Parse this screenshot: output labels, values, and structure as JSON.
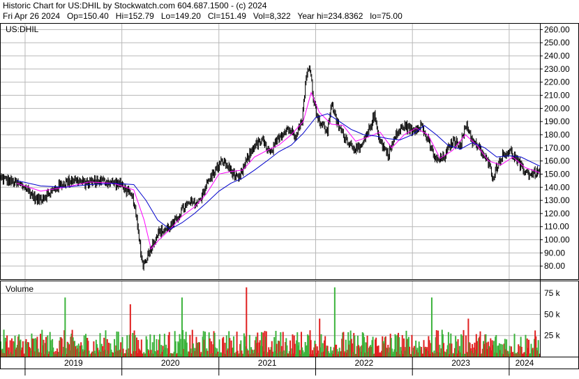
{
  "header": {
    "line1": "Historic Chart for US:DHIL by Stockwatch.com 604.687.1500 - (c) 2024",
    "line2": "Fri Apr 26 2024   Op=150.40   Hi=152.79   Lo=149.20   Cl=151.49   Vol=8,322   Year hi=234.8362   lo=75.00"
  },
  "colors": {
    "price": "#000000",
    "ma_short": "#ff00ff",
    "ma_long": "#0000cc",
    "vol_up": "#3cb33c",
    "vol_down": "#e02020",
    "grid": "#b8b8b8",
    "frame": "#000000"
  },
  "chart_data": [
    {
      "type": "line",
      "panel": "price",
      "title": "US:DHIL",
      "ylim": [
        70,
        265
      ],
      "y_ticks": [
        80,
        90,
        100,
        110,
        120,
        130,
        140,
        150,
        160,
        170,
        180,
        190,
        200,
        210,
        220,
        230,
        240,
        250,
        260
      ],
      "x_tick_labels": [
        "2019",
        "2020",
        "2021",
        "2022",
        "2023",
        "2024"
      ],
      "x_start": "2018-10-01",
      "x_end": "2024-04-26",
      "grid": true,
      "series": [
        {
          "values": [
            {
              "date": "2018-10-01",
              "value": 147
            },
            {
              "date": "2018-11-15",
              "value": 144
            },
            {
              "date": "2019-01-01",
              "value": 140
            },
            {
              "date": "2019-02-15",
              "value": 130
            },
            {
              "date": "2019-04-01",
              "value": 135
            },
            {
              "date": "2019-05-15",
              "value": 142
            },
            {
              "date": "2019-07-01",
              "value": 146
            },
            {
              "date": "2019-08-15",
              "value": 143
            },
            {
              "date": "2019-10-01",
              "value": 145
            },
            {
              "date": "2019-11-15",
              "value": 144
            },
            {
              "date": "2020-01-01",
              "value": 142
            },
            {
              "date": "2020-02-15",
              "value": 130
            },
            {
              "date": "2020-03-20",
              "value": 80
            },
            {
              "date": "2020-04-15",
              "value": 92
            },
            {
              "date": "2020-05-15",
              "value": 105
            },
            {
              "date": "2020-06-15",
              "value": 108
            },
            {
              "date": "2020-07-15",
              "value": 112
            },
            {
              "date": "2020-08-15",
              "value": 123
            },
            {
              "date": "2020-09-15",
              "value": 128
            },
            {
              "date": "2020-10-15",
              "value": 128
            },
            {
              "date": "2020-11-15",
              "value": 142
            },
            {
              "date": "2020-12-15",
              "value": 152
            },
            {
              "date": "2021-01-15",
              "value": 160
            },
            {
              "date": "2021-02-15",
              "value": 153
            },
            {
              "date": "2021-03-15",
              "value": 145
            },
            {
              "date": "2021-04-15",
              "value": 160
            },
            {
              "date": "2021-05-15",
              "value": 172
            },
            {
              "date": "2021-06-15",
              "value": 175
            },
            {
              "date": "2021-07-15",
              "value": 165
            },
            {
              "date": "2021-08-15",
              "value": 178
            },
            {
              "date": "2021-09-15",
              "value": 185
            },
            {
              "date": "2021-10-15",
              "value": 180
            },
            {
              "date": "2021-11-10",
              "value": 190
            },
            {
              "date": "2021-11-25",
              "value": 222
            },
            {
              "date": "2021-12-10",
              "value": 233
            },
            {
              "date": "2021-12-25",
              "value": 205
            },
            {
              "date": "2022-01-15",
              "value": 190
            },
            {
              "date": "2022-02-15",
              "value": 182
            },
            {
              "date": "2022-03-01",
              "value": 205
            },
            {
              "date": "2022-03-20",
              "value": 190
            },
            {
              "date": "2022-04-15",
              "value": 180
            },
            {
              "date": "2022-05-15",
              "value": 172
            },
            {
              "date": "2022-06-15",
              "value": 168
            },
            {
              "date": "2022-07-15",
              "value": 180
            },
            {
              "date": "2022-08-10",
              "value": 195
            },
            {
              "date": "2022-09-01",
              "value": 175
            },
            {
              "date": "2022-10-01",
              "value": 165
            },
            {
              "date": "2022-11-01",
              "value": 180
            },
            {
              "date": "2022-12-01",
              "value": 187
            },
            {
              "date": "2023-01-01",
              "value": 183
            },
            {
              "date": "2023-02-01",
              "value": 188
            },
            {
              "date": "2023-03-01",
              "value": 175
            },
            {
              "date": "2023-04-01",
              "value": 160
            },
            {
              "date": "2023-05-01",
              "value": 163
            },
            {
              "date": "2023-06-01",
              "value": 175
            },
            {
              "date": "2023-07-01",
              "value": 173
            },
            {
              "date": "2023-07-25",
              "value": 188
            },
            {
              "date": "2023-08-15",
              "value": 175
            },
            {
              "date": "2023-09-15",
              "value": 168
            },
            {
              "date": "2023-10-15",
              "value": 158
            },
            {
              "date": "2023-11-01",
              "value": 148
            },
            {
              "date": "2023-12-01",
              "value": 163
            },
            {
              "date": "2024-01-01",
              "value": 168
            },
            {
              "date": "2024-01-25",
              "value": 162
            },
            {
              "date": "2024-02-15",
              "value": 155
            },
            {
              "date": "2024-03-15",
              "value": 150
            },
            {
              "date": "2024-04-26",
              "value": 151.49
            }
          ]
        },
        {
          "values": [
            {
              "date": "2018-12-01",
              "value": 143
            },
            {
              "date": "2019-03-01",
              "value": 137
            },
            {
              "date": "2019-06-01",
              "value": 140
            },
            {
              "date": "2019-09-01",
              "value": 144
            },
            {
              "date": "2019-12-01",
              "value": 143
            },
            {
              "date": "2020-02-15",
              "value": 138
            },
            {
              "date": "2020-03-25",
              "value": 115
            },
            {
              "date": "2020-04-20",
              "value": 93
            },
            {
              "date": "2020-05-20",
              "value": 100
            },
            {
              "date": "2020-07-01",
              "value": 108
            },
            {
              "date": "2020-08-15",
              "value": 118
            },
            {
              "date": "2020-10-01",
              "value": 125
            },
            {
              "date": "2020-11-15",
              "value": 135
            },
            {
              "date": "2021-01-01",
              "value": 150
            },
            {
              "date": "2021-02-15",
              "value": 152
            },
            {
              "date": "2021-04-01",
              "value": 153
            },
            {
              "date": "2021-05-15",
              "value": 163
            },
            {
              "date": "2021-07-01",
              "value": 168
            },
            {
              "date": "2021-08-15",
              "value": 172
            },
            {
              "date": "2021-10-01",
              "value": 180
            },
            {
              "date": "2021-11-15",
              "value": 190
            },
            {
              "date": "2021-12-15",
              "value": 212
            },
            {
              "date": "2022-01-15",
              "value": 197
            },
            {
              "date": "2022-03-01",
              "value": 188
            },
            {
              "date": "2022-04-15",
              "value": 187
            },
            {
              "date": "2022-06-01",
              "value": 175
            },
            {
              "date": "2022-07-15",
              "value": 178
            },
            {
              "date": "2022-09-01",
              "value": 182
            },
            {
              "date": "2022-10-15",
              "value": 170
            },
            {
              "date": "2022-12-01",
              "value": 180
            },
            {
              "date": "2023-01-15",
              "value": 185
            },
            {
              "date": "2023-03-01",
              "value": 180
            },
            {
              "date": "2023-04-15",
              "value": 162
            },
            {
              "date": "2023-06-01",
              "value": 168
            },
            {
              "date": "2023-07-20",
              "value": 180
            },
            {
              "date": "2023-09-01",
              "value": 172
            },
            {
              "date": "2023-10-15",
              "value": 160
            },
            {
              "date": "2023-12-01",
              "value": 157
            },
            {
              "date": "2024-01-15",
              "value": 163
            },
            {
              "date": "2024-03-01",
              "value": 155
            },
            {
              "date": "2024-04-26",
              "value": 151
            }
          ]
        },
        {
          "values": [
            {
              "date": "2018-12-01",
              "value": 145
            },
            {
              "date": "2019-03-01",
              "value": 141
            },
            {
              "date": "2019-06-01",
              "value": 140
            },
            {
              "date": "2019-09-01",
              "value": 142
            },
            {
              "date": "2019-12-01",
              "value": 143
            },
            {
              "date": "2020-02-15",
              "value": 142
            },
            {
              "date": "2020-04-01",
              "value": 130
            },
            {
              "date": "2020-05-15",
              "value": 115
            },
            {
              "date": "2020-07-01",
              "value": 108
            },
            {
              "date": "2020-08-15",
              "value": 113
            },
            {
              "date": "2020-10-01",
              "value": 120
            },
            {
              "date": "2020-11-15",
              "value": 128
            },
            {
              "date": "2021-01-01",
              "value": 137
            },
            {
              "date": "2021-02-15",
              "value": 143
            },
            {
              "date": "2021-04-01",
              "value": 147
            },
            {
              "date": "2021-05-15",
              "value": 153
            },
            {
              "date": "2021-07-01",
              "value": 160
            },
            {
              "date": "2021-08-15",
              "value": 167
            },
            {
              "date": "2021-10-01",
              "value": 172
            },
            {
              "date": "2021-11-15",
              "value": 181
            },
            {
              "date": "2022-01-01",
              "value": 193
            },
            {
              "date": "2022-02-15",
              "value": 196
            },
            {
              "date": "2022-04-01",
              "value": 190
            },
            {
              "date": "2022-05-15",
              "value": 184
            },
            {
              "date": "2022-07-01",
              "value": 180
            },
            {
              "date": "2022-08-15",
              "value": 179
            },
            {
              "date": "2022-10-01",
              "value": 177
            },
            {
              "date": "2022-11-15",
              "value": 176
            },
            {
              "date": "2023-01-01",
              "value": 180
            },
            {
              "date": "2023-02-15",
              "value": 187
            },
            {
              "date": "2023-04-01",
              "value": 180
            },
            {
              "date": "2023-05-15",
              "value": 172
            },
            {
              "date": "2023-07-01",
              "value": 169
            },
            {
              "date": "2023-08-15",
              "value": 174
            },
            {
              "date": "2023-10-01",
              "value": 170
            },
            {
              "date": "2023-11-15",
              "value": 163
            },
            {
              "date": "2024-01-01",
              "value": 164
            },
            {
              "date": "2024-02-15",
              "value": 163
            },
            {
              "date": "2024-04-26",
              "value": 156
            }
          ]
        }
      ]
    },
    {
      "type": "bar",
      "panel": "volume",
      "title": "Volume",
      "y_ticks": [
        25,
        50,
        75
      ],
      "y_tick_labels": [
        "25 k",
        "50 k",
        "75 k"
      ],
      "ylim": [
        0,
        90
      ],
      "grid": true,
      "spikes_thousands": [
        {
          "date": "2019-06-01",
          "value": 70
        },
        {
          "date": "2020-02-01",
          "value": 62
        },
        {
          "date": "2020-08-15",
          "value": 70
        },
        {
          "date": "2021-04-15",
          "value": 82
        },
        {
          "date": "2022-03-15",
          "value": 82
        },
        {
          "date": "2023-03-15",
          "value": 70
        },
        {
          "date": "2022-01-15",
          "value": 45
        },
        {
          "date": "2023-08-01",
          "value": 45
        }
      ],
      "typical_range_thousands": [
        3,
        32
      ]
    }
  ]
}
